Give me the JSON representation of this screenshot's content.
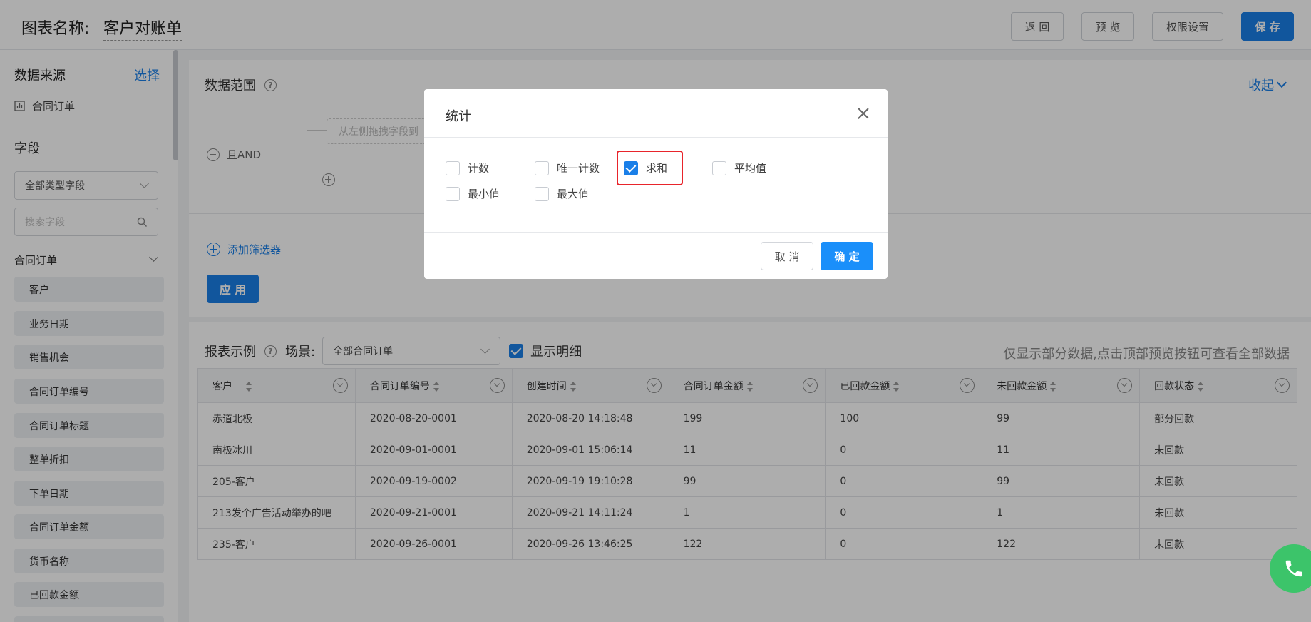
{
  "header": {
    "title_label": "图表名称:",
    "title_value": "客户对账单",
    "buttons": {
      "back": "返 回",
      "preview": "预 览",
      "permissions": "权限设置",
      "save": "保 存"
    }
  },
  "sidebar": {
    "data_source_label": "数据来源",
    "select_link": "选择",
    "source_name": "合同订单",
    "fields_label": "字段",
    "field_type_select": "全部类型字段",
    "search_placeholder": "搜索字段",
    "group_name": "合同订单",
    "fields": [
      "客户",
      "业务日期",
      "销售机会",
      "合同订单编号",
      "合同订单标题",
      "整单折扣",
      "下单日期",
      "合同订单金额",
      "货币名称",
      "已回款金额"
    ]
  },
  "data_range": {
    "title": "数据范围",
    "collapse": "收起",
    "and_label": "且AND",
    "drop_hint": "从左侧拖拽字段到",
    "add_filter": "添加筛选器",
    "apply": "应 用"
  },
  "report": {
    "title": "报表示例",
    "scene_label": "场景:",
    "scene_value": "全部合同订单",
    "show_detail": "显示明细",
    "note": "仅显示部分数据,点击顶部预览按钮可查看全部数据",
    "columns": [
      "客户",
      "合同订单编号",
      "创建时间",
      "合同订单金额",
      "已回款金额",
      "未回款金额",
      "回款状态"
    ],
    "rows": [
      [
        "赤道北极",
        "2020-08-20-0001",
        "2020-08-20 14:18:48",
        "199",
        "100",
        "99",
        "部分回款"
      ],
      [
        "南极冰川",
        "2020-09-01-0001",
        "2020-09-01 15:06:14",
        "11",
        "0",
        "11",
        "未回款"
      ],
      [
        "205-客户",
        "2020-09-19-0002",
        "2020-09-19 19:10:28",
        "99",
        "0",
        "99",
        "未回款"
      ],
      [
        "213发个广告活动举办的吧",
        "2020-09-21-0001",
        "2020-09-21 14:11:24",
        "1",
        "0",
        "1",
        "未回款"
      ],
      [
        "235-客户",
        "2020-09-26-0001",
        "2020-09-26 13:46:25",
        "122",
        "0",
        "122",
        "未回款"
      ]
    ]
  },
  "modal": {
    "title": "统计",
    "options": {
      "count": "计数",
      "unique_count": "唯一计数",
      "sum": "求和",
      "avg": "平均值",
      "min": "最小值",
      "max": "最大值"
    },
    "cancel": "取 消",
    "confirm": "确 定"
  },
  "colors": {
    "accent": "#1a7fe8",
    "highlight": "#e8242b",
    "phone": "#3cc46a"
  }
}
